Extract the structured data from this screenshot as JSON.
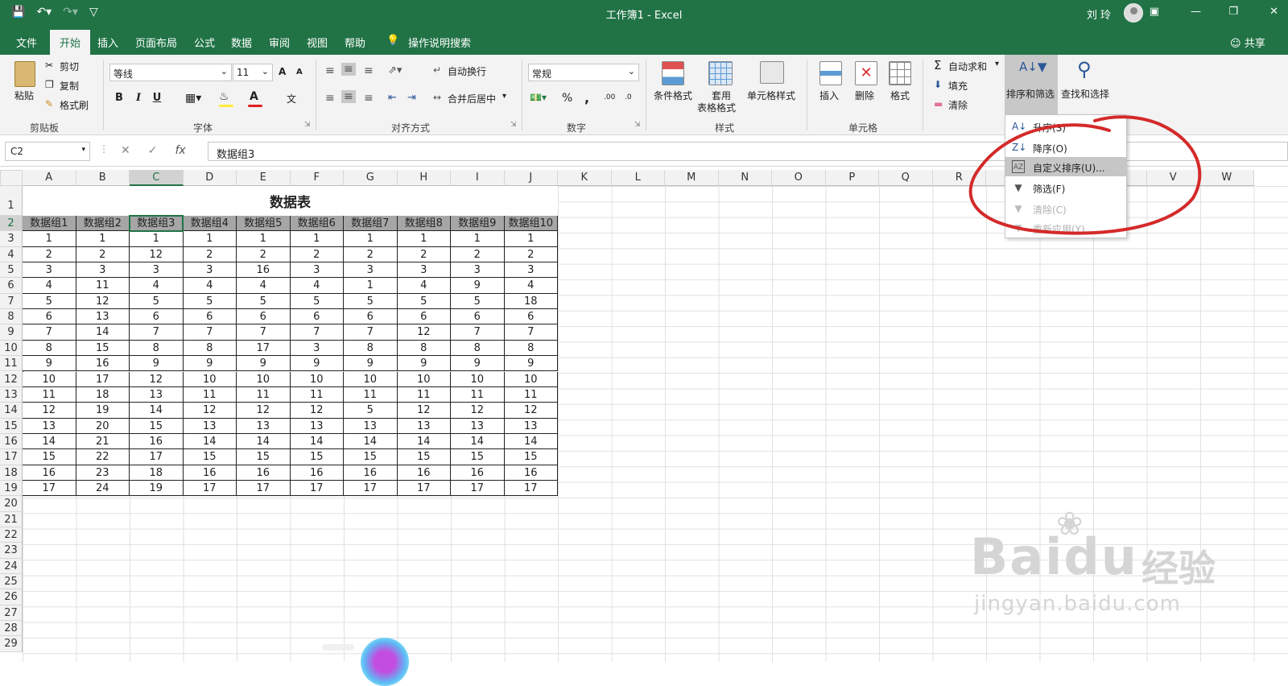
{
  "window": {
    "title": "工作簿1 - Excel",
    "user": "刘 玲",
    "share": "共享"
  },
  "tabs": [
    "文件",
    "开始",
    "插入",
    "页面布局",
    "公式",
    "数据",
    "审阅",
    "视图",
    "帮助",
    "操作说明搜索"
  ],
  "active_tab": "开始",
  "ribbon": {
    "clipboard": {
      "paste": "粘贴",
      "cut": "剪切",
      "copy": "复制",
      "format_painter": "格式刷",
      "label": "剪贴板"
    },
    "font": {
      "name": "等线",
      "size": "11",
      "label": "字体",
      "bold": "B",
      "italic": "I",
      "underline": "U",
      "grow": "A",
      "shrink": "A",
      "phonetic": "文"
    },
    "alignment": {
      "wrap": "自动换行",
      "merge": "合并后居中",
      "label": "对齐方式"
    },
    "number": {
      "format": "常规",
      "percent": "%",
      "comma": ",",
      "inc_decimal": ".00",
      "dec_decimal": ".0",
      "label": "数字"
    },
    "styles": {
      "conditional": "条件格式",
      "table_format_line1": "套用",
      "table_format_line2": "表格格式",
      "cell_styles": "单元格样式",
      "label": "样式"
    },
    "cells": {
      "insert": "插入",
      "delete": "删除",
      "format": "格式",
      "label": "单元格"
    },
    "editing": {
      "autosum": "自动求和",
      "fill": "填充",
      "clear": "清除",
      "sort_filter": "排序和筛选",
      "find_select": "查找和选择"
    }
  },
  "formula_bar": {
    "name_box": "C2",
    "formula": "数据组3",
    "fx": "fx"
  },
  "columns": [
    "A",
    "B",
    "C",
    "D",
    "E",
    "F",
    "G",
    "H",
    "I",
    "J",
    "K",
    "L",
    "M",
    "N",
    "O",
    "P",
    "Q",
    "R",
    "S",
    "T",
    "U",
    "V",
    "W"
  ],
  "rows": [
    "1",
    "2",
    "3",
    "4",
    "5",
    "6",
    "7",
    "8",
    "9",
    "10",
    "11",
    "12",
    "13",
    "14",
    "15",
    "16",
    "17",
    "18",
    "19",
    "20",
    "21",
    "22",
    "23",
    "24",
    "25",
    "26",
    "27",
    "28",
    "29"
  ],
  "sheet": {
    "title": "数据表",
    "headers": [
      "数据组1",
      "数据组2",
      "数据组3",
      "数据组4",
      "数据组5",
      "数据组6",
      "数据组7",
      "数据组8",
      "数据组9",
      "数据组10"
    ],
    "data": [
      [
        "1",
        "1",
        "1",
        "1",
        "1",
        "1",
        "1",
        "1",
        "1",
        "1"
      ],
      [
        "2",
        "2",
        "12",
        "2",
        "2",
        "2",
        "2",
        "2",
        "2",
        "2"
      ],
      [
        "3",
        "3",
        "3",
        "3",
        "16",
        "3",
        "3",
        "3",
        "3",
        "3"
      ],
      [
        "4",
        "11",
        "4",
        "4",
        "4",
        "4",
        "1",
        "4",
        "9",
        "4"
      ],
      [
        "5",
        "12",
        "5",
        "5",
        "5",
        "5",
        "5",
        "5",
        "5",
        "18"
      ],
      [
        "6",
        "13",
        "6",
        "6",
        "6",
        "6",
        "6",
        "6",
        "6",
        "6"
      ],
      [
        "7",
        "14",
        "7",
        "7",
        "7",
        "7",
        "7",
        "12",
        "7",
        "7"
      ],
      [
        "8",
        "15",
        "8",
        "8",
        "17",
        "3",
        "8",
        "8",
        "8",
        "8"
      ],
      [
        "9",
        "16",
        "9",
        "9",
        "9",
        "9",
        "9",
        "9",
        "9",
        "9"
      ],
      [
        "10",
        "17",
        "12",
        "10",
        "10",
        "10",
        "10",
        "10",
        "10",
        "10"
      ],
      [
        "11",
        "18",
        "13",
        "11",
        "11",
        "11",
        "11",
        "11",
        "11",
        "11"
      ],
      [
        "12",
        "19",
        "14",
        "12",
        "12",
        "12",
        "5",
        "12",
        "12",
        "12"
      ],
      [
        "13",
        "20",
        "15",
        "13",
        "13",
        "13",
        "13",
        "13",
        "13",
        "13"
      ],
      [
        "14",
        "21",
        "16",
        "14",
        "14",
        "14",
        "14",
        "14",
        "14",
        "14"
      ],
      [
        "15",
        "22",
        "17",
        "15",
        "15",
        "15",
        "15",
        "15",
        "15",
        "15"
      ],
      [
        "16",
        "23",
        "18",
        "16",
        "16",
        "16",
        "16",
        "16",
        "16",
        "16"
      ],
      [
        "17",
        "24",
        "19",
        "17",
        "17",
        "17",
        "17",
        "17",
        "17",
        "17"
      ]
    ],
    "selected_cell": "C2"
  },
  "sort_menu": {
    "items": [
      {
        "label": "升序(S)",
        "icon": "sort-ascending-icon",
        "state": "normal"
      },
      {
        "label": "降序(O)",
        "icon": "sort-descending-icon",
        "state": "normal"
      },
      {
        "label": "自定义排序(U)...",
        "icon": "custom-sort-icon",
        "state": "hover"
      },
      {
        "label": "筛选(F)",
        "icon": "filter-icon",
        "state": "normal"
      },
      {
        "label": "清除(C)",
        "icon": "clear-filter-icon",
        "state": "disabled"
      },
      {
        "label": "重新应用(Y)",
        "icon": "reapply-icon",
        "state": "disabled"
      }
    ]
  },
  "watermark": {
    "brand": "Baidu",
    "brand_cn": "经验",
    "url": "jingyan.baidu.com"
  },
  "colors": {
    "excel_green": "#217346",
    "annotation_red": "#d42a2a",
    "header_fill": "#a6a6a6"
  }
}
